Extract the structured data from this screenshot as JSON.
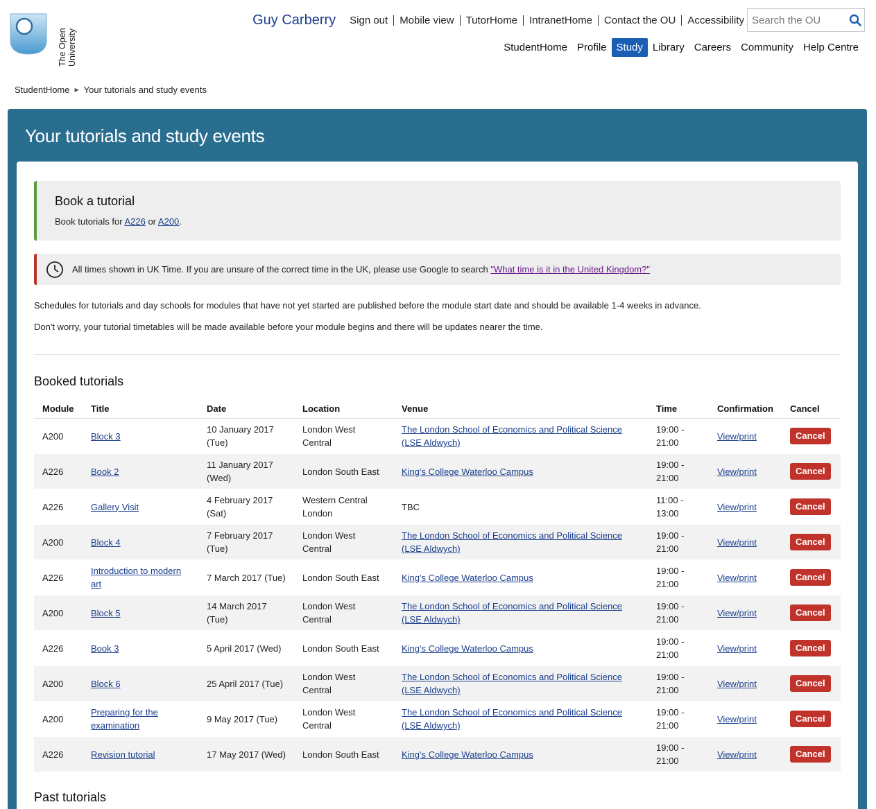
{
  "brand": {
    "logo_text": "The Open University"
  },
  "header": {
    "user_name": "Guy Carberry",
    "top_links": [
      "Sign out",
      "Mobile view",
      "TutorHome",
      "IntranetHome",
      "Contact the OU",
      "Accessibility"
    ],
    "search_placeholder": "Search the OU",
    "main_nav": [
      "StudentHome",
      "Profile",
      "Study",
      "Library",
      "Careers",
      "Community",
      "Help Centre"
    ],
    "active_nav": "Study",
    "active_color": "#1a5fb4"
  },
  "breadcrumb": {
    "home": "StudentHome",
    "current": "Your tutorials and study events"
  },
  "page": {
    "title": "Your tutorials and study events",
    "book": {
      "heading": "Book a tutorial",
      "text_prefix": "Book tutorials for",
      "link1": "A226",
      "text_mid": "or",
      "link2": "A200",
      "text_suffix": "."
    },
    "time_notice": {
      "text": "All times shown in UK Time. If you are unsure of the correct time in the UK, please use Google to search",
      "link": "\"What time is it in the United Kingdom?\""
    },
    "para1": "Schedules for tutorials and day schools for modules that have not yet started are published before the module start date and should be available 1-4 weeks in advance.",
    "para2": "Don't worry, your tutorial timetables will be made available before your module begins and there will be updates nearer the time.",
    "booked_title": "Booked tutorials",
    "past_title": "Past tutorials"
  },
  "table": {
    "headers": [
      "Module",
      "Title",
      "Date",
      "Location",
      "Venue",
      "Time",
      "Confirmation",
      "Cancel"
    ],
    "rows": [
      {
        "module": "A200",
        "title": "Block 3",
        "date": "10 January 2017 (Tue)",
        "location": "London West Central",
        "venue": "The London School of Economics and Political Science (LSE Aldwych)",
        "venue_link": true,
        "time": "19:00 - 21:00",
        "confirmation": "View/print",
        "cancel": "Cancel"
      },
      {
        "module": "A226",
        "title": "Book 2",
        "date": "11 January 2017 (Wed)",
        "location": "London South East",
        "venue": "King's College Waterloo Campus",
        "venue_link": true,
        "time": "19:00 - 21:00",
        "confirmation": "View/print",
        "cancel": "Cancel"
      },
      {
        "module": "A226",
        "title": "Gallery Visit",
        "date": "4 February 2017 (Sat)",
        "location": "Western Central London",
        "venue": "TBC",
        "venue_link": false,
        "time": "11:00 - 13:00",
        "confirmation": "View/print",
        "cancel": "Cancel"
      },
      {
        "module": "A200",
        "title": "Block 4",
        "date": "7 February 2017 (Tue)",
        "location": "London West Central",
        "venue": "The London School of Economics and Political Science (LSE Aldwych)",
        "venue_link": true,
        "time": "19:00 - 21:00",
        "confirmation": "View/print",
        "cancel": "Cancel"
      },
      {
        "module": "A226",
        "title": "Introduction to modern art",
        "date": "7 March 2017 (Tue)",
        "location": "London South East",
        "venue": "King's College Waterloo Campus",
        "venue_link": true,
        "time": "19:00 - 21:00",
        "confirmation": "View/print",
        "cancel": "Cancel"
      },
      {
        "module": "A200",
        "title": "Block 5",
        "date": "14 March 2017 (Tue)",
        "location": "London West Central",
        "venue": "The London School of Economics and Political Science (LSE Aldwych)",
        "venue_link": true,
        "time": "19:00 - 21:00",
        "confirmation": "View/print",
        "cancel": "Cancel"
      },
      {
        "module": "A226",
        "title": "Book 3",
        "date": "5 April 2017 (Wed)",
        "location": "London South East",
        "venue": "King's College Waterloo Campus",
        "venue_link": true,
        "time": "19:00 - 21:00",
        "confirmation": "View/print",
        "cancel": "Cancel"
      },
      {
        "module": "A200",
        "title": "Block 6",
        "date": "25 April 2017 (Tue)",
        "location": "London West Central",
        "venue": "The London School of Economics and Political Science (LSE Aldwych)",
        "venue_link": true,
        "time": "19:00 - 21:00",
        "confirmation": "View/print",
        "cancel": "Cancel"
      },
      {
        "module": "A200",
        "title": "Preparing for the examination",
        "date": "9 May 2017 (Tue)",
        "location": "London West Central",
        "venue": "The London School of Economics and Political Science (LSE Aldwych)",
        "venue_link": true,
        "time": "19:00 - 21:00",
        "confirmation": "View/print",
        "cancel": "Cancel"
      },
      {
        "module": "A226",
        "title": "Revision tutorial",
        "date": "17 May 2017 (Wed)",
        "location": "London South East",
        "venue": "King's College Waterloo Campus",
        "venue_link": true,
        "time": "19:00 - 21:00",
        "confirmation": "View/print",
        "cancel": "Cancel"
      }
    ]
  },
  "colors": {
    "panel": "#2a6e8f",
    "book_accent": "#5c9c3c",
    "notice_accent": "#b83428",
    "cancel_button": "#c0332b",
    "link": "#1a3e8c"
  }
}
